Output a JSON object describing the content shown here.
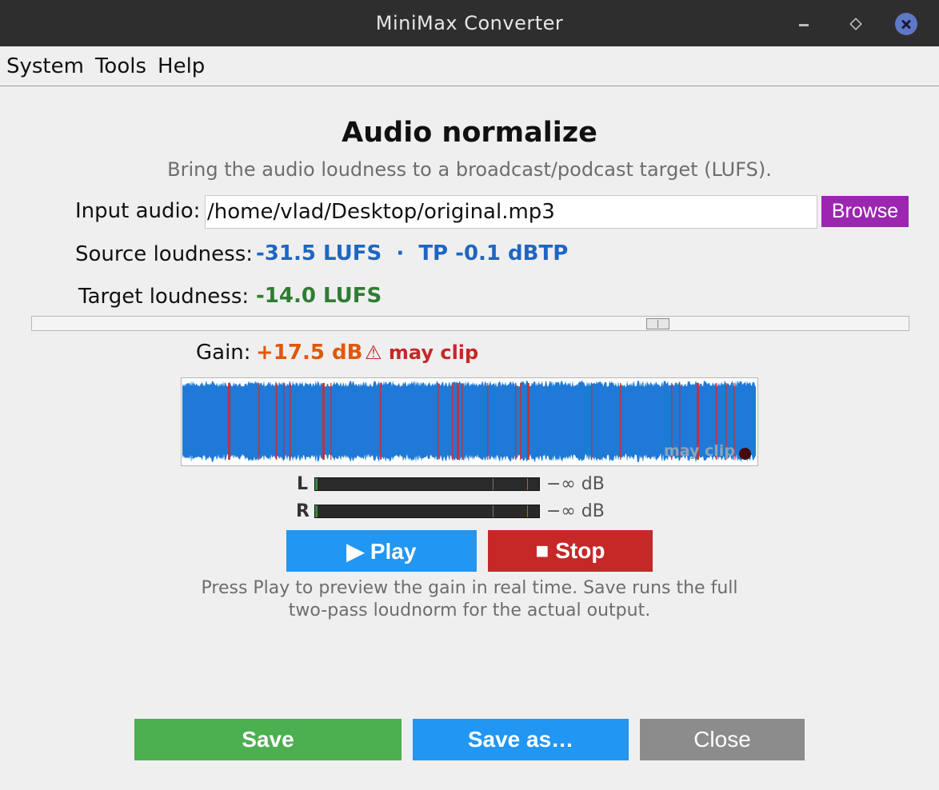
{
  "window": {
    "title": "MiniMax Converter"
  },
  "menu": {
    "items": [
      "System",
      "Tools",
      "Help"
    ]
  },
  "page": {
    "heading": "Audio normalize",
    "subtitle": "Bring the audio loudness to a broadcast/podcast target (LUFS)."
  },
  "input": {
    "label": "Input audio:",
    "value": "/home/vlad/Desktop/original.mp3",
    "browse_label": "Browse"
  },
  "source": {
    "label": "Source loudness:",
    "value": "-31.5 LUFS  ·  TP -0.1 dBTP"
  },
  "target": {
    "label": "Target loudness:",
    "value": "-14.0 LUFS",
    "slider_fraction": 0.72
  },
  "gain": {
    "label": "Gain:",
    "value": "+17.5 dB",
    "warning": "⚠ may clip"
  },
  "waveform": {
    "note": "may clip"
  },
  "meters": {
    "left": {
      "channel": "L",
      "value": "−∞ dB"
    },
    "right": {
      "channel": "R",
      "value": "−∞ dB"
    }
  },
  "transport": {
    "play_label": "▶ Play",
    "stop_label": "■ Stop"
  },
  "hint": {
    "line1": "Press Play to preview the gain in real time. Save runs the full",
    "line2": "two-pass loudnorm for the actual output."
  },
  "footer": {
    "save_label": "Save",
    "save_as_label": "Save as…",
    "close_label": "Close"
  },
  "colors": {
    "accent_blue": "#2196f3",
    "browse_purple": "#9b27b0",
    "stop_red": "#c62828",
    "save_green": "#4caf50",
    "waveform_blue": "#1e7ad6",
    "clip_red": "#d62828"
  }
}
